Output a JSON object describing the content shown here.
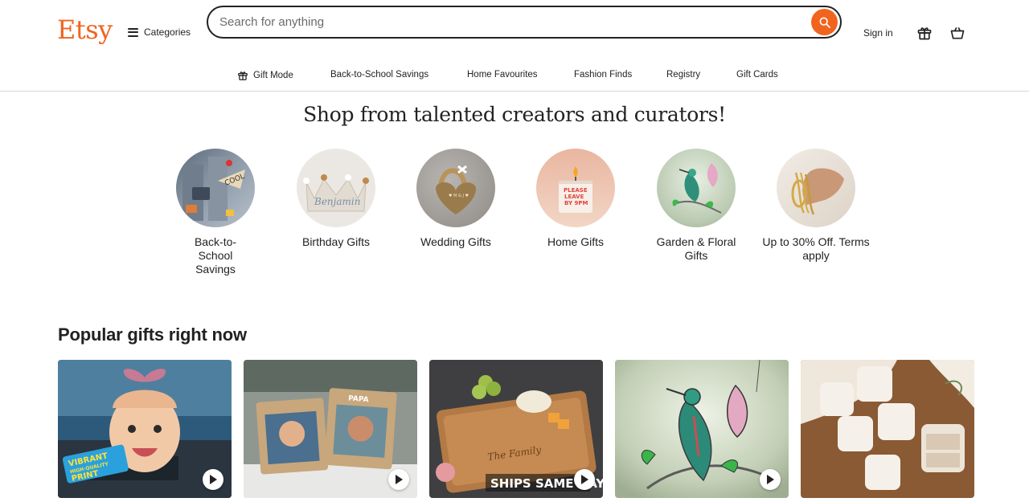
{
  "brand": {
    "logo": "Etsy",
    "accent": "#F1641E"
  },
  "header": {
    "categories_label": "Categories",
    "search_placeholder": "Search for anything",
    "signin_label": "Sign in"
  },
  "nav": {
    "items": [
      {
        "label": "Gift Mode",
        "icon": "gift-icon"
      },
      {
        "label": "Back-to-School Savings"
      },
      {
        "label": "Home Favourites"
      },
      {
        "label": "Fashion Finds"
      },
      {
        "label": "Registry"
      },
      {
        "label": "Gift Cards"
      }
    ]
  },
  "hero": {
    "title": "Shop from talented creators and curators!",
    "categories": [
      {
        "label": "Back-to-School Savings"
      },
      {
        "label": "Birthday Gifts"
      },
      {
        "label": "Wedding Gifts"
      },
      {
        "label": "Home Gifts"
      },
      {
        "label": "Garden & Floral Gifts"
      },
      {
        "label": "Up to 30% Off. Terms apply"
      }
    ]
  },
  "popular": {
    "title": "Popular gifts right now",
    "cards": [
      {
        "name": "baby face car air freshener",
        "badge": "VIBRANT HIGH-QUALITY PRINT"
      },
      {
        "name": "personalised photo frames",
        "frame_text": "PAPA"
      },
      {
        "name": "engraved charcuterie board",
        "badge": "SHIPS SAME DAY"
      },
      {
        "name": "stained glass hummingbird"
      },
      {
        "name": "personalised jewellery boxes"
      }
    ]
  }
}
